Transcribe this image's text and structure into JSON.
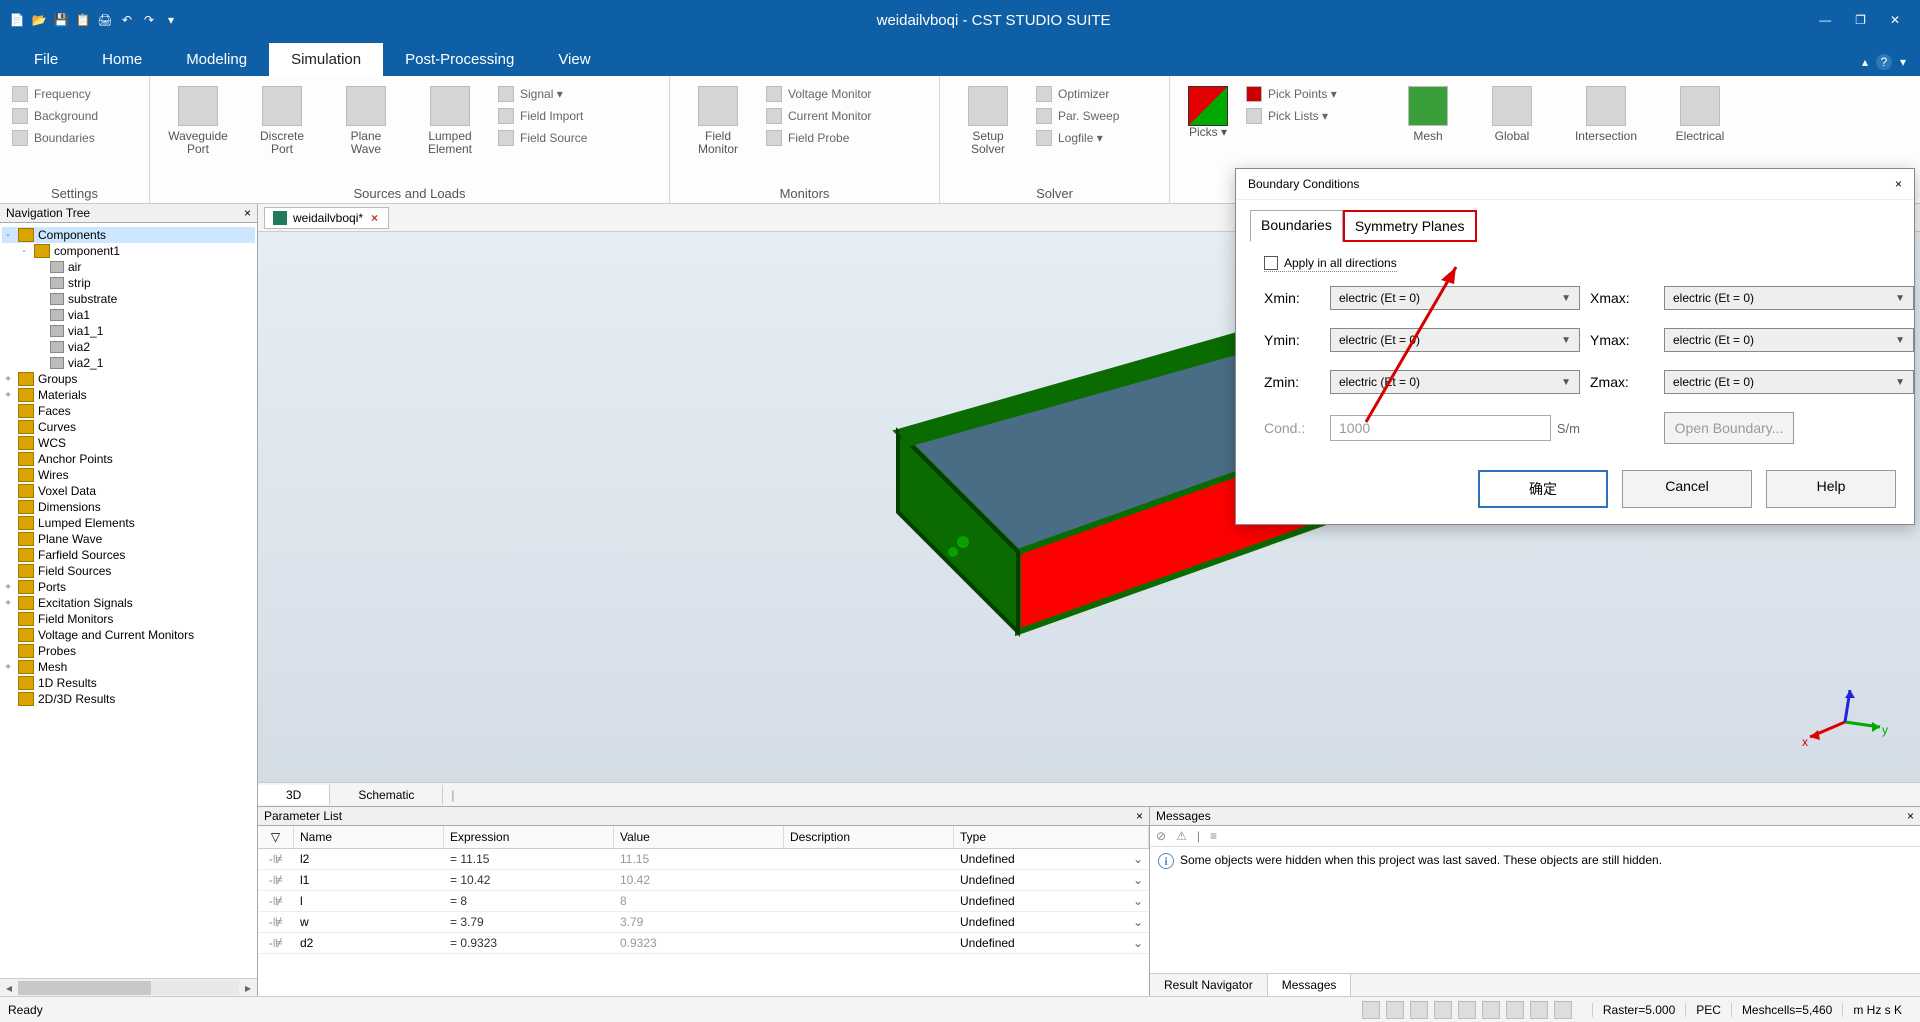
{
  "app": {
    "title": "weidailvboqi - CST STUDIO SUITE"
  },
  "menu": {
    "items": [
      "File",
      "Home",
      "Modeling",
      "Simulation",
      "Post-Processing",
      "View"
    ],
    "active": "Simulation"
  },
  "ribbon": {
    "settings": {
      "items": [
        "Frequency",
        "Background",
        "Boundaries"
      ],
      "label": "Settings"
    },
    "sources": {
      "big": [
        {
          "l1": "Waveguide",
          "l2": "Port"
        },
        {
          "l1": "Discrete",
          "l2": "Port"
        },
        {
          "l1": "Plane",
          "l2": "Wave"
        },
        {
          "l1": "Lumped",
          "l2": "Element"
        }
      ],
      "small": [
        "Signal ▾",
        "Field Import",
        "Field Source"
      ],
      "label": "Sources and Loads"
    },
    "monitors": {
      "big": {
        "l1": "Field",
        "l2": "Monitor"
      },
      "small": [
        "Voltage Monitor",
        "Current Monitor",
        "Field Probe"
      ],
      "label": "Monitors"
    },
    "solver": {
      "big": {
        "l1": "Setup",
        "l2": "Solver"
      },
      "small": [
        "Optimizer",
        "Par. Sweep",
        "Logfile ▾"
      ],
      "label": "Solver"
    },
    "picks": {
      "label": "Picks ▾",
      "small": [
        "Pick Points ▾",
        "Pick Lists ▾"
      ]
    },
    "mesh": {
      "big": [
        {
          "l1": "Mesh",
          "l2": ""
        },
        {
          "l1": "Global",
          "l2": ""
        },
        {
          "l1": "Intersection",
          "l2": ""
        },
        {
          "l1": "Electrical",
          "l2": ""
        }
      ]
    }
  },
  "nav": {
    "title": "Navigation Tree",
    "items": [
      {
        "t": "Components",
        "lvl": 0,
        "sel": true,
        "exp": "-",
        "ico": "f"
      },
      {
        "t": "component1",
        "lvl": 1,
        "exp": "-",
        "ico": "f"
      },
      {
        "t": "air",
        "lvl": 2,
        "ico": "c"
      },
      {
        "t": "strip",
        "lvl": 2,
        "ico": "c"
      },
      {
        "t": "substrate",
        "lvl": 2,
        "ico": "c"
      },
      {
        "t": "via1",
        "lvl": 2,
        "ico": "c"
      },
      {
        "t": "via1_1",
        "lvl": 2,
        "ico": "c"
      },
      {
        "t": "via2",
        "lvl": 2,
        "ico": "c"
      },
      {
        "t": "via2_1",
        "lvl": 2,
        "ico": "c"
      },
      {
        "t": "Groups",
        "lvl": 0,
        "exp": "+",
        "ico": "f"
      },
      {
        "t": "Materials",
        "lvl": 0,
        "exp": "+",
        "ico": "f"
      },
      {
        "t": "Faces",
        "lvl": 0,
        "ico": "f"
      },
      {
        "t": "Curves",
        "lvl": 0,
        "ico": "f"
      },
      {
        "t": "WCS",
        "lvl": 0,
        "ico": "f"
      },
      {
        "t": "Anchor Points",
        "lvl": 0,
        "ico": "f"
      },
      {
        "t": "Wires",
        "lvl": 0,
        "ico": "f"
      },
      {
        "t": "Voxel Data",
        "lvl": 0,
        "ico": "f"
      },
      {
        "t": "Dimensions",
        "lvl": 0,
        "ico": "f"
      },
      {
        "t": "Lumped Elements",
        "lvl": 0,
        "ico": "f"
      },
      {
        "t": "Plane Wave",
        "lvl": 0,
        "ico": "f"
      },
      {
        "t": "Farfield Sources",
        "lvl": 0,
        "ico": "f"
      },
      {
        "t": "Field Sources",
        "lvl": 0,
        "ico": "f"
      },
      {
        "t": "Ports",
        "lvl": 0,
        "exp": "+",
        "ico": "f"
      },
      {
        "t": "Excitation Signals",
        "lvl": 0,
        "exp": "+",
        "ico": "f"
      },
      {
        "t": "Field Monitors",
        "lvl": 0,
        "ico": "f"
      },
      {
        "t": "Voltage and Current Monitors",
        "lvl": 0,
        "ico": "f"
      },
      {
        "t": "Probes",
        "lvl": 0,
        "ico": "f"
      },
      {
        "t": "Mesh",
        "lvl": 0,
        "exp": "+",
        "ico": "f"
      },
      {
        "t": "1D Results",
        "lvl": 0,
        "ico": "f"
      },
      {
        "t": "2D/3D Results",
        "lvl": 0,
        "ico": "f"
      }
    ]
  },
  "doc": {
    "tab": "weidailvboqi*"
  },
  "viewtabs": {
    "items": [
      "3D",
      "Schematic"
    ],
    "active": "3D"
  },
  "params": {
    "title": "Parameter List",
    "headers": {
      "name": "Name",
      "expr": "Expression",
      "val": "Value",
      "desc": "Description",
      "type": "Type"
    },
    "rows": [
      {
        "name": "l2",
        "expr": "= 11.15",
        "val": "11.15",
        "type": "Undefined"
      },
      {
        "name": "l1",
        "expr": "= 10.42",
        "val": "10.42",
        "type": "Undefined"
      },
      {
        "name": "l",
        "expr": "= 8",
        "val": "8",
        "type": "Undefined"
      },
      {
        "name": "w",
        "expr": "= 3.79",
        "val": "3.79",
        "type": "Undefined"
      },
      {
        "name": "d2",
        "expr": "= 0.9323",
        "val": "0.9323",
        "type": "Undefined"
      }
    ]
  },
  "messages": {
    "title": "Messages",
    "text": "Some objects were hidden when this project was last saved. These objects are still hidden.",
    "tabs": {
      "nav": "Result Navigator",
      "msg": "Messages"
    }
  },
  "dialog": {
    "title": "Boundary Conditions",
    "tabs": {
      "b": "Boundaries",
      "s": "Symmetry Planes"
    },
    "apply": "Apply in all directions",
    "xmin": "Xmin:",
    "xmax": "Xmax:",
    "ymin": "Ymin:",
    "ymax": "Ymax:",
    "zmin": "Zmin:",
    "zmax": "Zmax:",
    "cond": "Cond.:",
    "condval": "1000",
    "unit": "S/m",
    "val": "electric (Et = 0)",
    "open": "Open Boundary...",
    "ok": "确定",
    "cancel": "Cancel",
    "help": "Help"
  },
  "status": {
    "ready": "Ready",
    "raster": "Raster=5.000",
    "pec": "PEC",
    "mesh": "Meshcells=5,460",
    "units": "m  Hz  s  K"
  }
}
